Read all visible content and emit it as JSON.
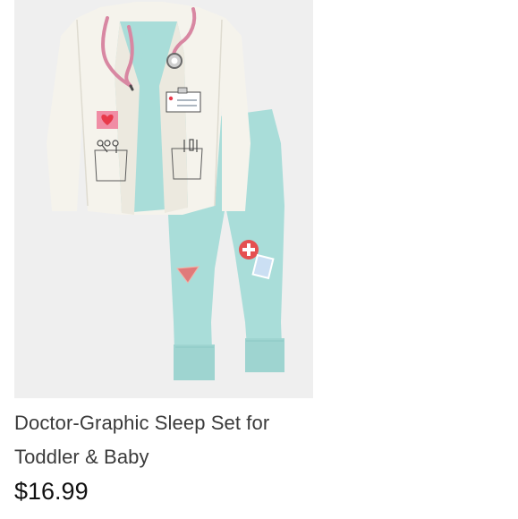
{
  "product": {
    "image_icon": "doctor-pajama-set-image",
    "title_line1": "Doctor-Graphic Sleep Set for",
    "title_line2": "Toddler & Baby",
    "price": "$16.99",
    "colors": {
      "shirt": "#f5f3ec",
      "scrubs": "#a9ddd9",
      "stethoscope": "#d887a2",
      "heart": "#e8394a"
    }
  }
}
